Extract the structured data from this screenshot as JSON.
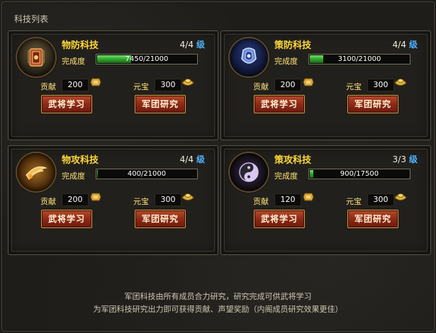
{
  "title": "科技列表",
  "panels": [
    {
      "name": "物防科技",
      "level_value": "4/4",
      "level_unit": "级",
      "progress_label": "完成度",
      "progress_text": "7450/21000",
      "progress": 0.355,
      "contribution_label": "贡献",
      "contribution_cost": "200",
      "ingot_label": "元宝",
      "ingot_cost": "300",
      "learn_button": "武将学习",
      "research_button": "军团研究",
      "icon": "shield-armor-icon"
    },
    {
      "name": "策防科技",
      "level_value": "4/4",
      "level_unit": "级",
      "progress_label": "完成度",
      "progress_text": "3100/21000",
      "progress": 0.148,
      "contribution_label": "贡献",
      "contribution_cost": "200",
      "ingot_label": "元宝",
      "ingot_cost": "300",
      "learn_button": "武将学习",
      "research_button": "军团研究",
      "icon": "blue-armor-icon"
    },
    {
      "name": "物攻科技",
      "level_value": "4/4",
      "level_unit": "级",
      "progress_label": "完成度",
      "progress_text": "400/21000",
      "progress": 0.019,
      "contribution_label": "贡献",
      "contribution_cost": "200",
      "ingot_label": "元宝",
      "ingot_cost": "300",
      "learn_button": "武将学习",
      "research_button": "军团研究",
      "icon": "sword-slash-icon"
    },
    {
      "name": "策攻科技",
      "level_value": "3/3",
      "level_unit": "级",
      "progress_label": "完成度",
      "progress_text": "900/17500",
      "progress": 0.051,
      "contribution_label": "贡献",
      "contribution_cost": "120",
      "ingot_label": "元宝",
      "ingot_cost": "300",
      "learn_button": "武将学习",
      "research_button": "军团研究",
      "icon": "taiji-icon"
    }
  ],
  "footer": {
    "line1": "军团科技由所有成员合力研究，研究完成可供武将学习",
    "line2": "为军团科技研究出力即可获得贡献、声望奖励（内阁成员研究效果更佳）"
  },
  "colors": {
    "name": "#ffd83a",
    "level_unit": "#4eb3ff",
    "progress_fill": "#2f9e2c",
    "button": "#8e2a16"
  }
}
